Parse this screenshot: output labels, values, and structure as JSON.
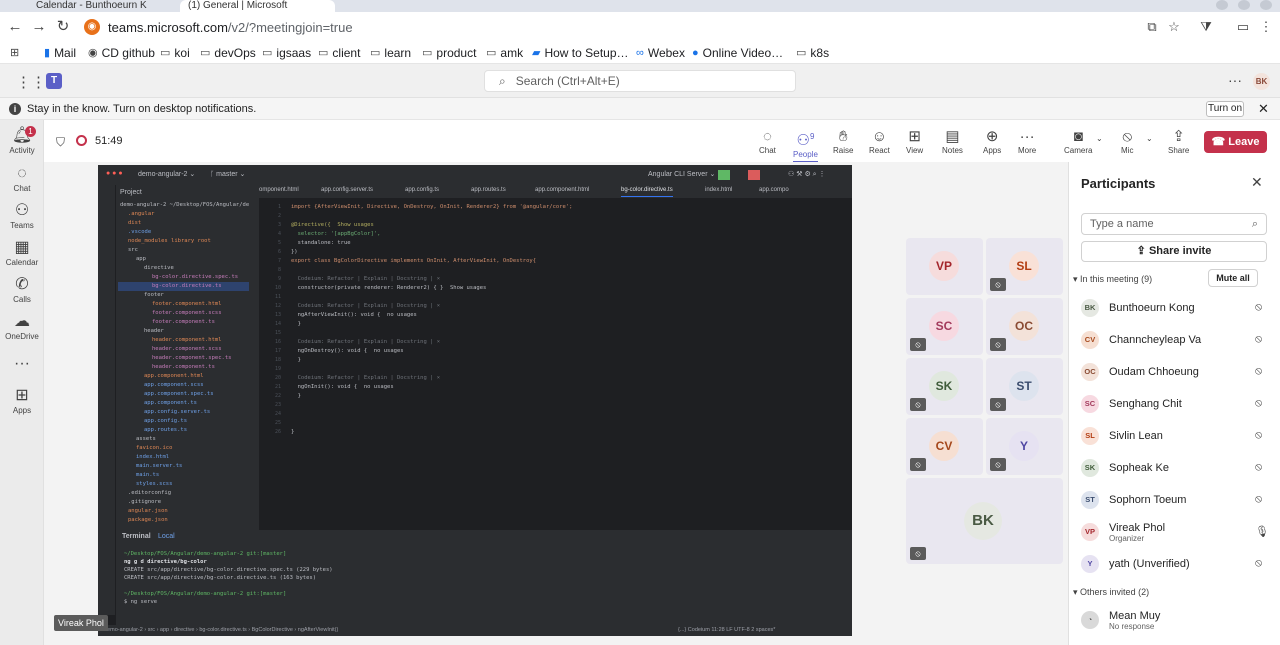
{
  "browser": {
    "tabs": [
      "Calendar - Bunthoeurn K",
      "(1) General | Microsoft"
    ],
    "url_main": "teams.microsoft.com",
    "url_rest": "/v2/?meetingjoin=true",
    "bookmarks": [
      "Mail",
      "CD github",
      "koi",
      "devOps",
      "igsaas",
      "client",
      "learn",
      "product",
      "amk",
      "How to Setup…",
      "Webex",
      "Online Video…",
      "k8s"
    ]
  },
  "teams": {
    "search_placeholder": "Search (Ctrl+Alt+E)",
    "avatar_initials": "BK",
    "notification": "Stay in the know. Turn on desktop notifications.",
    "turn_on_label": "Turn on",
    "rail": [
      {
        "icon": "bell-icon",
        "label": "Activity",
        "badge": "1"
      },
      {
        "icon": "chat-icon",
        "label": "Chat"
      },
      {
        "icon": "teams-icon",
        "label": "Teams"
      },
      {
        "icon": "calendar-icon",
        "label": "Calendar"
      },
      {
        "icon": "phone-icon",
        "label": "Calls"
      },
      {
        "icon": "onedrive-icon",
        "label": "OneDrive"
      },
      {
        "icon": "more-icon",
        "label": ""
      },
      {
        "icon": "apps-icon",
        "label": "Apps"
      }
    ]
  },
  "meeting": {
    "timer": "51:49",
    "people_count": "9",
    "controls": [
      "Chat",
      "People",
      "Raise",
      "React",
      "View",
      "Notes",
      "Apps",
      "More"
    ],
    "camera_label": "Camera",
    "mic_label": "Mic",
    "share_label": "Share",
    "leave_label": "Leave",
    "presenter_tag": "Vireak Phol",
    "tiles": [
      {
        "initials": "VP",
        "bg": "#f6dcdc",
        "fg": "#a4262c",
        "muted": false
      },
      {
        "initials": "SL",
        "bg": "#f9e1d7",
        "fg": "#b33d12",
        "muted": true
      },
      {
        "initials": "SC",
        "bg": "#f7d9e1",
        "fg": "#a33a5c",
        "muted": true
      },
      {
        "initials": "OC",
        "bg": "#f3e2d9",
        "fg": "#8a4b33",
        "muted": true
      },
      {
        "initials": "SK",
        "bg": "#e0e8de",
        "fg": "#3f5c3a",
        "muted": true
      },
      {
        "initials": "ST",
        "bg": "#dde3ee",
        "fg": "#3b4d6e",
        "muted": true
      },
      {
        "initials": "CV",
        "bg": "#f6dfd2",
        "fg": "#a5481c",
        "muted": true
      },
      {
        "initials": "Y",
        "bg": "#e6e2f2",
        "fg": "#4f46a3",
        "muted": true
      },
      {
        "initials": "BK",
        "bg": "#e5e8e2",
        "fg": "#4a5a44",
        "muted": true
      }
    ]
  },
  "ide": {
    "project": "demo-angular-2",
    "branch": "master",
    "run_config": "Angular CLI Server",
    "project_label": "Project",
    "tree": [
      "demo-angular-2 ~/Desktop/FOS/Angular/de",
      ".angular",
      "dist",
      ".vscode",
      "node_modules library root",
      "src",
      "app",
      "directive",
      "bg-color.directive.spec.ts",
      "bg-color.directive.ts",
      "footer",
      "footer.component.html",
      "footer.component.scss",
      "footer.component.ts",
      "header",
      "header.component.html",
      "header.component.scss",
      "header.component.spec.ts",
      "header.component.ts",
      "app.component.html",
      "app.component.scss",
      "app.component.spec.ts",
      "app.component.ts",
      "app.config.server.ts",
      "app.config.ts",
      "app.routes.ts",
      "assets",
      "favicon.ico",
      "index.html",
      "main.server.ts",
      "main.ts",
      "styles.scss",
      ".editorconfig",
      ".gitignore",
      "angular.json",
      "package.json"
    ],
    "tabs": [
      "omponent.html",
      "app.config.server.ts",
      "app.config.ts",
      "app.routes.ts",
      "app.component.html",
      "bg-color.directive.ts",
      "index.html",
      "app.compo"
    ],
    "code": [
      "import {AfterViewInit, Directive, OnDestroy, OnInit, Renderer2} from '@angular/core';",
      "",
      "@Directive({  Show usages",
      "  selector: '[appBgColor]',",
      "  standalone: true",
      "})",
      "export class BgColorDirective implements OnInit, AfterViewInit, OnDestroy{",
      "",
      "  Codeium: Refactor | Explain | Docstring | ×",
      "  constructor(private renderer: Renderer2) { }  Show usages",
      "",
      "  Codeium: Refactor | Explain | Docstring | ×",
      "  ngAfterViewInit(): void {  no usages",
      "  }",
      "",
      "  Codeium: Refactor | Explain | Docstring | ×",
      "  ngOnDestroy(): void {  no usages",
      "  }",
      "",
      "  Codeium: Refactor | Explain | Docstring | ×",
      "  ngOnInit(): void {  no usages",
      "  }",
      "",
      "",
      "",
      "}"
    ],
    "terminal_tabs": [
      "Terminal",
      "Local"
    ],
    "terminal": [
      "~/Desktop/FOS/Angular/demo-angular-2 git:[master]",
      "ng g d directive/bg-color",
      "CREATE src/app/directive/bg-color.directive.spec.ts (229 bytes)",
      "CREATE src/app/directive/bg-color.directive.ts (163 bytes)",
      "",
      "~/Desktop/FOS/Angular/demo-angular-2 git:[master]",
      "$ ng serve"
    ],
    "status": "demo-angular-2 › src › app › directive › bg-color.directive.ts › BgColorDirective › ngAfterViewInit()",
    "status_right": "{...} Codeium  11:28  LF  UTF-8  2 spaces*"
  },
  "participants": {
    "title": "Participants",
    "search_placeholder": "Type a name",
    "share_invite": "Share invite",
    "in_meeting": "In this meeting (9)",
    "mute_all": "Mute all",
    "list": [
      {
        "initials": "BK",
        "name": "Bunthoeurn Kong",
        "sub": "",
        "bg": "#e5e8e2",
        "fg": "#4a5a44",
        "mic": "mic-off-icon"
      },
      {
        "initials": "CV",
        "name": "Channcheyleap Va",
        "sub": "",
        "bg": "#f6dfd2",
        "fg": "#a5481c",
        "mic": "mic-off-icon"
      },
      {
        "initials": "OC",
        "name": "Oudam Chhoeung",
        "sub": "",
        "bg": "#f3e2d9",
        "fg": "#8a4b33",
        "mic": "mic-off-icon"
      },
      {
        "initials": "SC",
        "name": "Senghang Chit",
        "sub": "",
        "bg": "#f7d9e1",
        "fg": "#a33a5c",
        "mic": "mic-off-icon"
      },
      {
        "initials": "SL",
        "name": "Sivlin Lean",
        "sub": "",
        "bg": "#f9e1d7",
        "fg": "#b33d12",
        "mic": "mic-off-icon"
      },
      {
        "initials": "SK",
        "name": "Sopheak Ke",
        "sub": "",
        "bg": "#e0e8de",
        "fg": "#3f5c3a",
        "mic": "mic-off-icon"
      },
      {
        "initials": "ST",
        "name": "Sophorn Toeum",
        "sub": "",
        "bg": "#dde3ee",
        "fg": "#3b4d6e",
        "mic": "mic-off-icon"
      },
      {
        "initials": "VP",
        "name": "Vireak Phol",
        "sub": "Organizer",
        "bg": "#f6dcdc",
        "fg": "#a4262c",
        "mic": "mic-on-icon"
      },
      {
        "initials": "Y",
        "name": "yath (Unverified)",
        "sub": "",
        "bg": "#e6e2f2",
        "fg": "#4f46a3",
        "mic": "mic-off-icon"
      }
    ],
    "others_label": "Others invited (2)",
    "invited": [
      {
        "name": "Mean Muy",
        "sub": "No response"
      }
    ]
  }
}
